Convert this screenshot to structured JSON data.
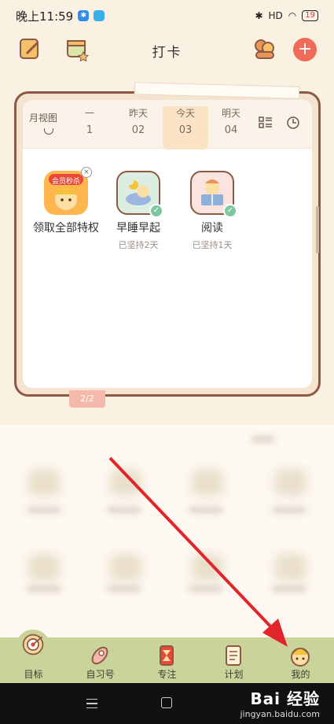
{
  "status_bar": {
    "time": "晚上11:59",
    "network": "HD",
    "battery": "19"
  },
  "header": {
    "title": "打卡"
  },
  "calendar": {
    "month_view_label": "月视图",
    "days": [
      {
        "weekday": "一",
        "date": "1"
      },
      {
        "weekday": "昨天",
        "date": "02"
      },
      {
        "weekday": "今天",
        "date": "03",
        "selected": true
      },
      {
        "weekday": "明天",
        "date": "04"
      }
    ]
  },
  "habits": [
    {
      "name": "领取全部特权",
      "sub": "",
      "badge": "会员秒杀",
      "icon": "member-promo-icon"
    },
    {
      "name": "早睡早起",
      "sub": "已坚持2天",
      "icon": "sleep-icon",
      "checked": true
    },
    {
      "name": "阅读",
      "sub": "已坚持1天",
      "icon": "reading-icon",
      "checked": true
    }
  ],
  "pager": {
    "label": "2/2"
  },
  "tabbar": {
    "items": [
      {
        "label": "目标",
        "icon": "target-icon"
      },
      {
        "label": "自习号",
        "icon": "rocket-icon"
      },
      {
        "label": "专注",
        "icon": "hourglass-icon"
      },
      {
        "label": "计划",
        "icon": "notes-icon"
      },
      {
        "label": "我的",
        "icon": "avatar-icon"
      }
    ]
  },
  "watermark": {
    "title": "Bai 经验",
    "url": "jingyan.baidu.com"
  },
  "colors": {
    "accent": "#f06a5a",
    "tabbar": "#c9d39a",
    "frame": "#8c5a42",
    "today": "#fbe4c6",
    "check": "#7cc7a1",
    "arrow": "#e0262a"
  }
}
